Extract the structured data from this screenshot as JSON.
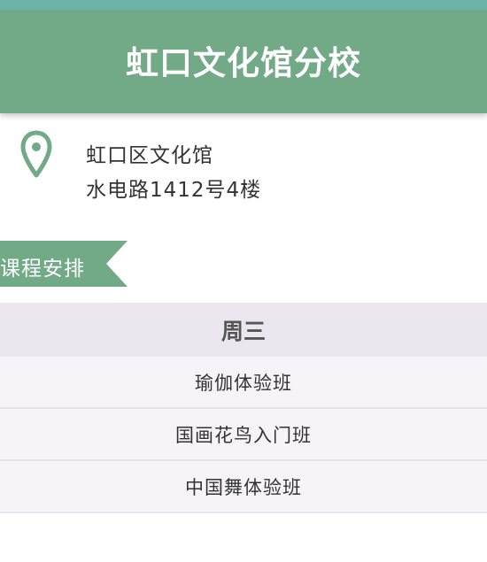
{
  "header": {
    "title": "虹口文化馆分校"
  },
  "location": {
    "icon": "location-pin-icon",
    "line1": "虹口区文化馆",
    "line2": "水电路1412号4楼"
  },
  "section": {
    "label": "课程安排"
  },
  "schedule": {
    "day": "周三",
    "courses": [
      "瑜伽体验班",
      "国画花鸟入门班",
      "中国舞体验班"
    ]
  },
  "colors": {
    "header_bg": "#72a986",
    "top_strip": "#6db3a9",
    "accent_green": "#72a986",
    "day_header_bg": "#ece6ee",
    "row_bg": "#f6f4f8"
  }
}
